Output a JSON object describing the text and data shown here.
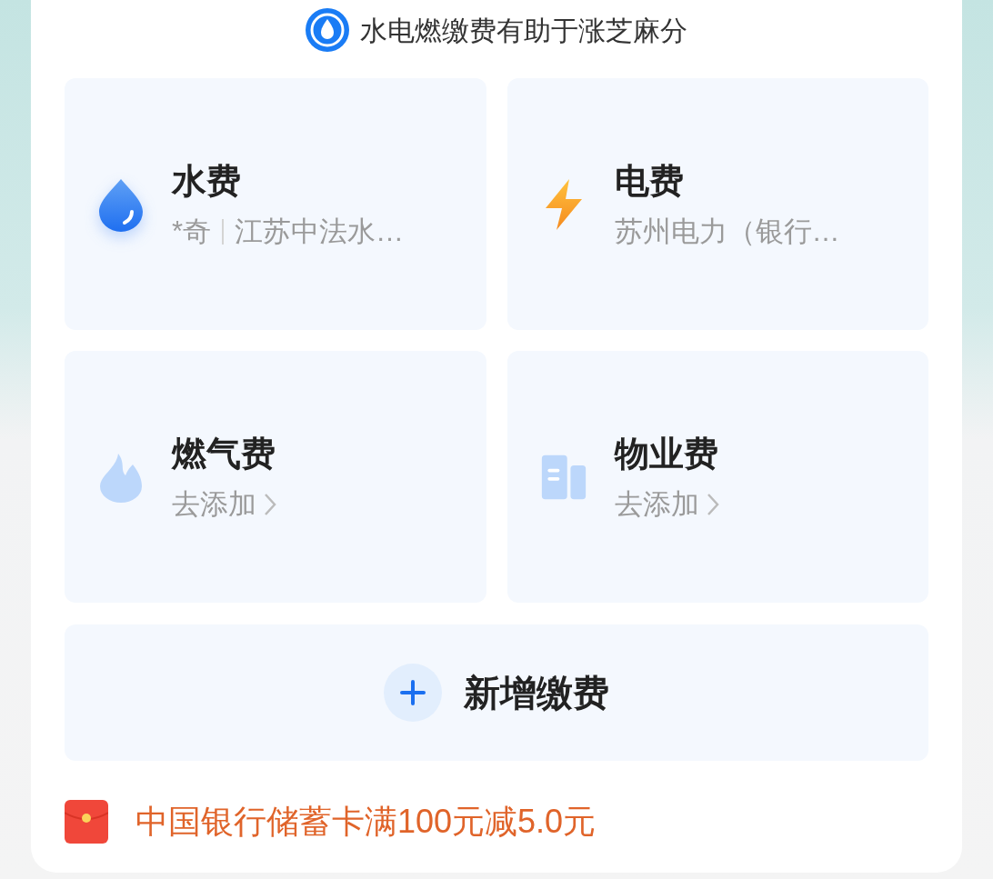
{
  "header": {
    "text": "水电燃缴费有助于涨芝麻分"
  },
  "tiles": [
    {
      "kind": "bound",
      "title": "水费",
      "account": "*奇",
      "detail": "江苏中法水…"
    },
    {
      "kind": "bound",
      "title": "电费",
      "detail": "苏州电力（银行…"
    },
    {
      "kind": "empty",
      "title": "燃气费",
      "detail": "去添加"
    },
    {
      "kind": "empty",
      "title": "物业费",
      "detail": "去添加"
    }
  ],
  "add_button": {
    "label": "新增缴费"
  },
  "promo": {
    "text": "中国银行储蓄卡满100元减5.0元"
  }
}
